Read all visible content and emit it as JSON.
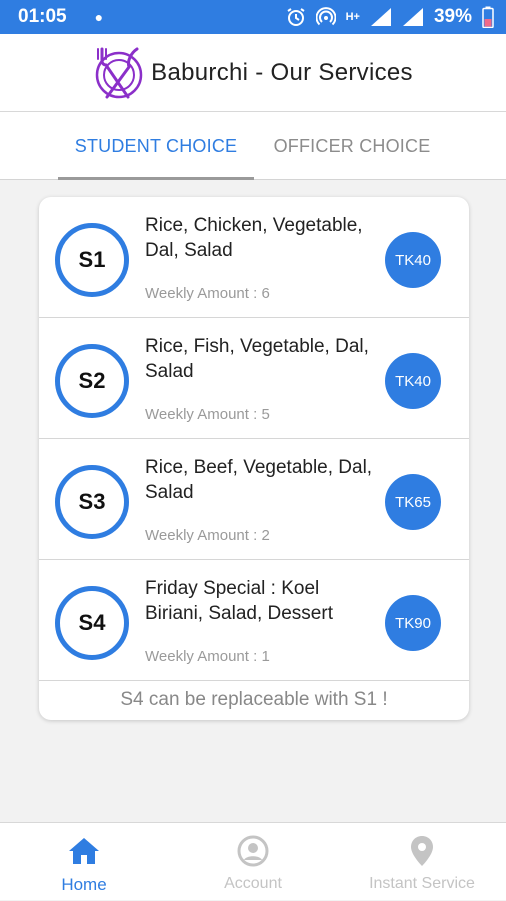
{
  "status_bar": {
    "time": "01:05",
    "battery": "39%",
    "network": "H+"
  },
  "app_bar": {
    "title": "Baburchi - Our Services"
  },
  "tabs": [
    {
      "label": "STUDENT CHOICE",
      "active": true
    },
    {
      "label": "OFFICER CHOICE",
      "active": false
    }
  ],
  "menu": [
    {
      "code": "S1",
      "description": "Rice, Chicken, Vegetable, Dal, Salad",
      "weekly": "Weekly Amount : 6",
      "price": "TK40"
    },
    {
      "code": "S2",
      "description": "Rice, Fish, Vegetable, Dal, Salad",
      "weekly": "Weekly Amount : 5",
      "price": "TK40"
    },
    {
      "code": "S3",
      "description": "Rice, Beef, Vegetable, Dal, Salad",
      "weekly": "Weekly Amount : 2",
      "price": "TK65"
    },
    {
      "code": "S4",
      "description": "Friday Special : Koel Biriani, Salad, Dessert",
      "weekly": "Weekly Amount : 1",
      "price": "TK90"
    }
  ],
  "note": "S4 can be replaceable with S1 !",
  "bottom_nav": [
    {
      "label": "Home",
      "icon": "home-icon",
      "active": true
    },
    {
      "label": "Account",
      "icon": "account-icon",
      "active": false
    },
    {
      "label": "Instant Service",
      "icon": "location-pin-icon",
      "active": false
    }
  ],
  "colors": {
    "accent": "#2f7de1",
    "muted": "#9a9a9a",
    "logo": "#8b2fc9"
  }
}
